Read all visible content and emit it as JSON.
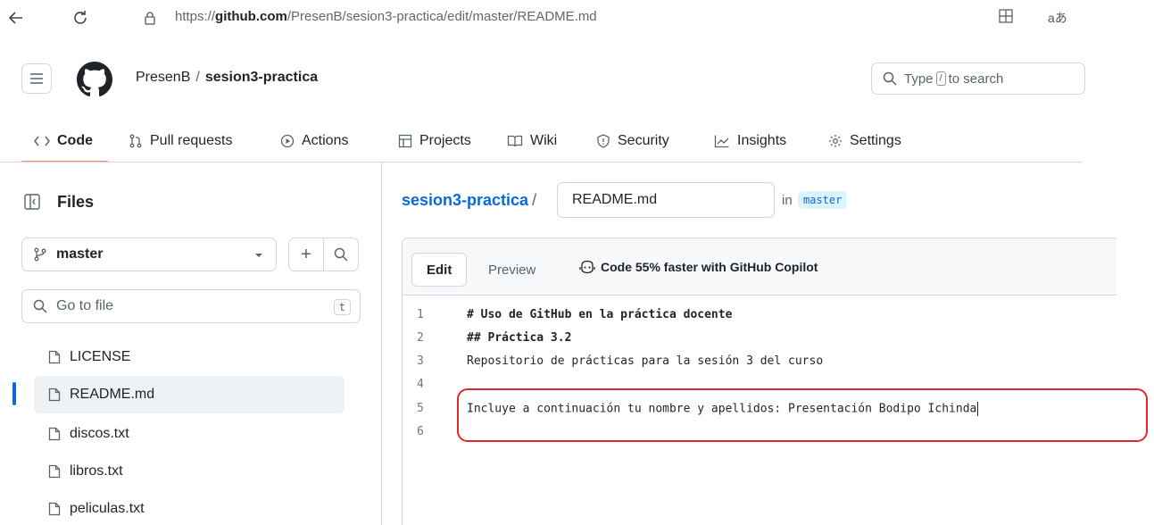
{
  "browser": {
    "url_prefix": "https://",
    "url_host": "github.com",
    "url_path": "/PresenB/sesion3-practica/edit/master/README.md",
    "reader_label": "aあ"
  },
  "header": {
    "owner": "PresenB",
    "separator": "/",
    "repo": "sesion3-practica",
    "search_before": "Type",
    "search_key": "/",
    "search_after": "to search"
  },
  "tabs": [
    {
      "label": "Code",
      "icon": "code-icon"
    },
    {
      "label": "Pull requests",
      "icon": "pull-request-icon"
    },
    {
      "label": "Actions",
      "icon": "play-icon"
    },
    {
      "label": "Projects",
      "icon": "table-icon"
    },
    {
      "label": "Wiki",
      "icon": "book-icon"
    },
    {
      "label": "Security",
      "icon": "shield-icon"
    },
    {
      "label": "Insights",
      "icon": "graph-icon"
    },
    {
      "label": "Settings",
      "icon": "gear-icon"
    }
  ],
  "sidebar": {
    "title": "Files",
    "branch": "master",
    "add_label": "+",
    "goto_placeholder": "Go to file",
    "goto_key": "t",
    "files": [
      {
        "name": "LICENSE",
        "selected": false
      },
      {
        "name": "README.md",
        "selected": true
      },
      {
        "name": "discos.txt",
        "selected": false
      },
      {
        "name": "libros.txt",
        "selected": false
      },
      {
        "name": "peliculas.txt",
        "selected": false
      }
    ]
  },
  "editor": {
    "repo_link": "sesion3-practica",
    "slash": "/",
    "filename": "README.md",
    "in_text": "in",
    "branch": "master",
    "tab_edit": "Edit",
    "tab_preview": "Preview",
    "copilot_text": "Code 55% faster with GitHub Copilot",
    "lines": [
      {
        "n": "1",
        "text": "# Uso de GitHub en la práctica docente",
        "bold": true
      },
      {
        "n": "2",
        "text": "## Práctica 3.2",
        "bold": true
      },
      {
        "n": "3",
        "text": "Repositorio de prácticas para la sesión 3 del curso",
        "bold": false
      },
      {
        "n": "4",
        "text": "",
        "bold": false
      },
      {
        "n": "5",
        "text": "Incluye a continuación tu nombre y apellidos: Presentación Bodipo Ichinda",
        "bold": false
      },
      {
        "n": "6",
        "text": "",
        "bold": false
      }
    ]
  },
  "colors": {
    "accent_link": "#0969da",
    "tab_underline": "#fd8c73",
    "highlight_box": "#e0282e",
    "branch_pill_bg": "#ddf4ff"
  }
}
